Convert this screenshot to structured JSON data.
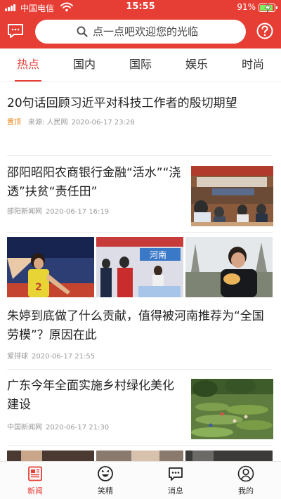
{
  "status": {
    "carrier": "中国电信",
    "time": "15:55",
    "battery_pct": "91%",
    "battery_level": 0.91
  },
  "header": {
    "search_placeholder": "点一点吧欢迎您的光临",
    "left_icon": "message-square-icon",
    "right_icon": "help-circle-icon"
  },
  "tabs": [
    {
      "label": "热点",
      "active": true
    },
    {
      "label": "国内",
      "active": false
    },
    {
      "label": "国际",
      "active": false
    },
    {
      "label": "娱乐",
      "active": false
    },
    {
      "label": "时尚",
      "active": false
    }
  ],
  "feed": [
    {
      "title": "20句话回顾习近平对科技工作者的殷切期望",
      "pin": "置顶",
      "source": "来源: 人民网",
      "time": "2020-06-17 23:28"
    },
    {
      "title": "邵阳昭阳农商银行金融“活水”“浇透”扶贫“责任田”",
      "source": "邵阳新闻网",
      "time": "2020-06-17 16:19"
    },
    {
      "title": "朱婷到底做了什么贡献，值得被河南推荐为“全国劳模”？原因在此",
      "source": "爱排球",
      "time": "2020-06-17 21:55",
      "image_caption": "河南"
    },
    {
      "title": "广东今年全面实施乡村绿化美化建设",
      "source": "中国新闻网",
      "time": "2020-06-17 21:30"
    }
  ],
  "bottom_nav": [
    {
      "label": "新闻",
      "icon": "newspaper-icon",
      "active": true
    },
    {
      "label": "笑精",
      "icon": "laugh-face-icon",
      "active": false
    },
    {
      "label": "消息",
      "icon": "message-icon",
      "active": false
    },
    {
      "label": "我的",
      "icon": "user-icon",
      "active": false
    }
  ],
  "colors": {
    "brand": "#e63d34",
    "pin": "#e8841a",
    "meta": "#999999",
    "battery": "#7ef05c"
  }
}
